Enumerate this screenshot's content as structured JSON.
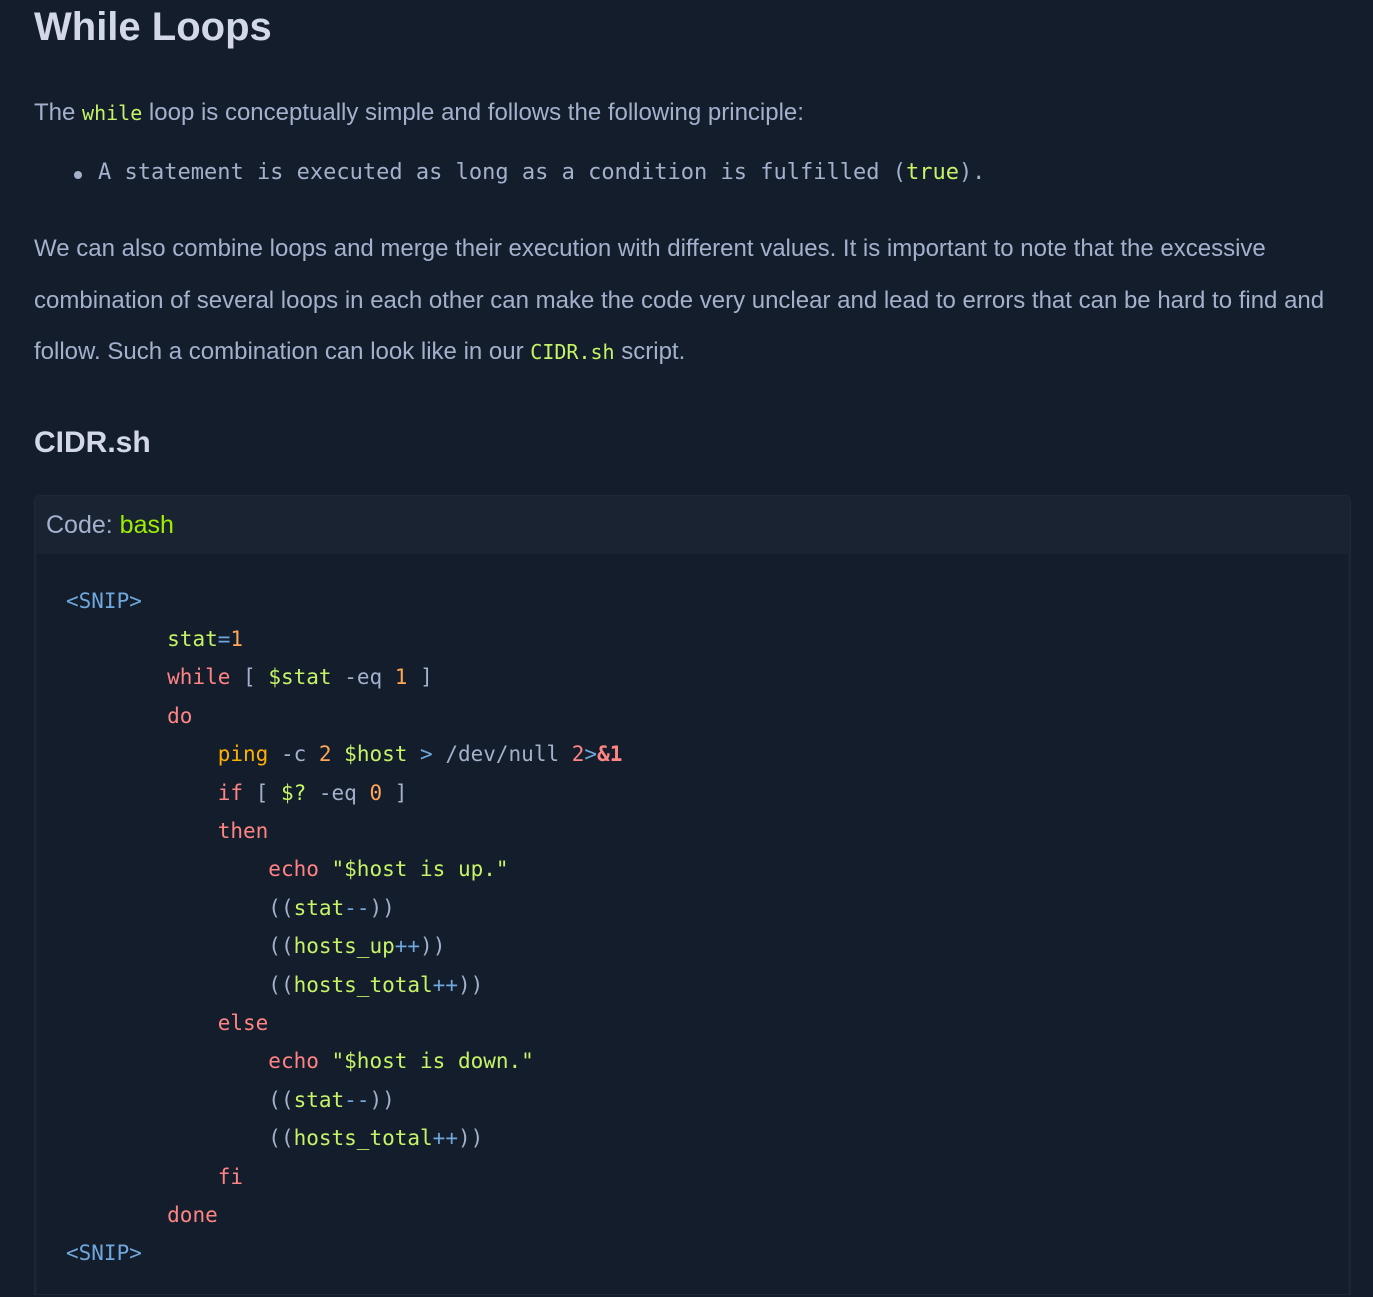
{
  "heading": "While Loops",
  "intro": {
    "before": "The ",
    "code": "while",
    "after": " loop is conceptually simple and follows the following principle:"
  },
  "bullet": {
    "before": "A statement is executed as long as a condition is fulfilled (",
    "code": "true",
    "after": ")."
  },
  "paragraph": {
    "before": "We can also combine loops and merge their execution with different values. It is important to note that the excessive combination of several loops in each other can make the code very unclear and lead to errors that can be hard to find and follow. Such a combination can look like in our ",
    "code": "CIDR.sh",
    "after": " script."
  },
  "subheading": "CIDR.sh",
  "code_block": {
    "label": "Code: ",
    "language": "bash"
  },
  "code": {
    "snip_open": "<SNIP>",
    "snip_close": "<SNIP>",
    "stat_var": "stat",
    "eq": "=",
    "one": "1",
    "while_kw": "while",
    "bracket_open": "[ ",
    "stat_ref": "$stat",
    "eq_flag": " -eq ",
    "one_b": "1",
    "bracket_close": " ]",
    "do_kw": "do",
    "ping_cmd": "ping",
    "ping_flag": " -c ",
    "two": "2",
    "host_ref": " $host",
    "redirect": " > ",
    "devnull": "/dev/null ",
    "fd_two": "2",
    "gt": ">",
    "amp_one": "&1",
    "if_kw": "if",
    "if_bracket_open": " [ ",
    "exit_ref": "$?",
    "if_eq": " -eq ",
    "zero": "0",
    "if_bracket_close": " ]",
    "then_kw": "then",
    "echo_up": "echo",
    "str_up": " \"$host is up.\"",
    "paren_open_1": "((",
    "stat_dec_var": "stat",
    "dec_op_1": "--",
    "paren_close_1": "))",
    "paren_open_2": "((",
    "hosts_up_var": "hosts_up",
    "inc_op_1": "++",
    "paren_close_2": "))",
    "paren_open_3": "((",
    "hosts_total_var_1": "hosts_total",
    "inc_op_2": "++",
    "paren_close_3": "))",
    "else_kw": "else",
    "echo_down": "echo",
    "str_down": " \"$host is down.\"",
    "paren_open_4": "((",
    "stat_dec_var_2": "stat",
    "dec_op_2": "--",
    "paren_close_4": "))",
    "paren_open_5": "((",
    "hosts_total_var_2": "hosts_total",
    "inc_op_3": "++",
    "paren_close_5": "))",
    "fi_kw": "fi",
    "done_kw": "done"
  },
  "colors": {
    "background": "#141d2b",
    "code_header_bg": "#1a2332",
    "text": "#a4b1cd",
    "heading": "#d3d8e8",
    "inline_code": "#c5f467",
    "language_label": "#9fef00",
    "keyword": "#ff8484",
    "number": "#ffa657",
    "command": "#ffaf00",
    "operator": "#6ea8dd"
  }
}
